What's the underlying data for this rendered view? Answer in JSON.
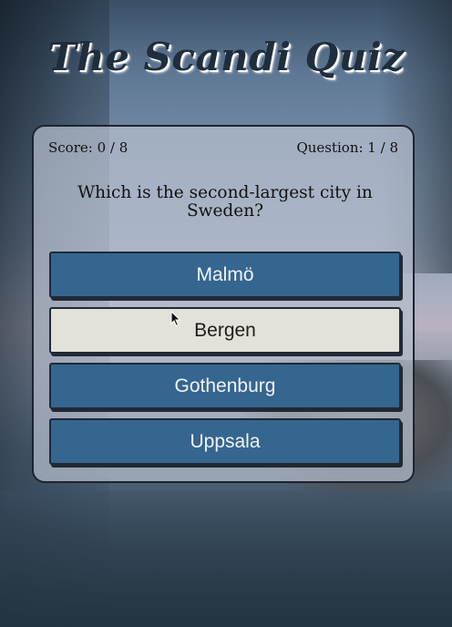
{
  "header": {
    "title": "The Scandi Quiz"
  },
  "quiz": {
    "score_text": "Score: 0 / 8",
    "question_counter": "Question: 1 / 8",
    "question": "Which is the second-largest city in Sweden?",
    "answers": [
      {
        "label": "Malmö",
        "state": "default"
      },
      {
        "label": "Bergen",
        "state": "hover"
      },
      {
        "label": "Gothenburg",
        "state": "default"
      },
      {
        "label": "Uppsala",
        "state": "default"
      }
    ]
  },
  "colors": {
    "answer_button": "#356690",
    "answer_hover": "#e2e1da",
    "title_text": "#1f2e3d"
  },
  "icons": {
    "cursor": "arrow-cursor-icon"
  }
}
